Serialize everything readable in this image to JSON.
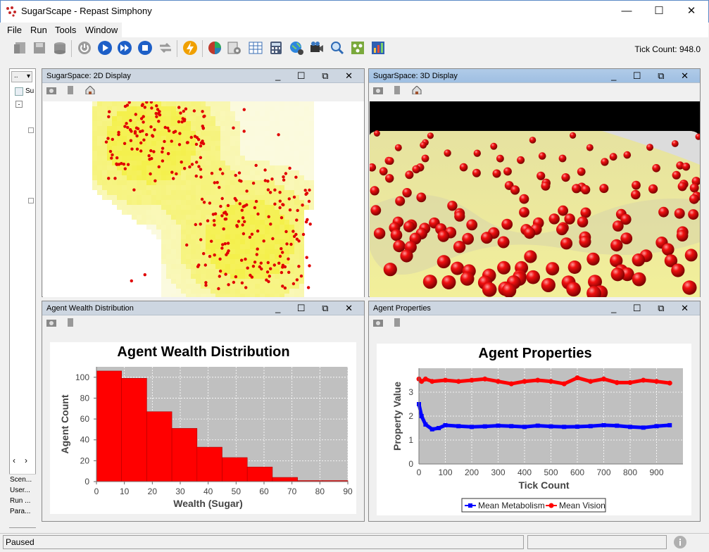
{
  "window": {
    "title": "SugarScape - Repast Simphony"
  },
  "menu": [
    "File",
    "Run",
    "Tools",
    "Window"
  ],
  "toolbar": {
    "tick_count": "Tick Count: 948.0"
  },
  "left_panel": {
    "tab_labels": [
      "Scen...",
      "User...",
      "Run ...",
      "Para..."
    ],
    "tree_item": "Su"
  },
  "frames": {
    "display2d": {
      "title": "SugarSpace: 2D Display"
    },
    "display3d": {
      "title": "SugarSpace: 3D Display"
    },
    "wealth": {
      "title": "Agent Wealth Distribution"
    },
    "props": {
      "title": "Agent Properties"
    }
  },
  "status": {
    "text": "Paused"
  },
  "chart_data": [
    {
      "type": "bar",
      "title": "Agent Wealth Distribution",
      "xlabel": "Wealth (Sugar)",
      "ylabel": "Agent Count",
      "bins": [
        [
          0,
          9
        ],
        [
          9,
          18
        ],
        [
          18,
          27
        ],
        [
          27,
          36
        ],
        [
          36,
          45
        ],
        [
          45,
          54
        ],
        [
          54,
          63
        ],
        [
          63,
          72
        ],
        [
          72,
          81
        ],
        [
          81,
          90
        ]
      ],
      "values": [
        106,
        99,
        67,
        51,
        33,
        23,
        14,
        4,
        1,
        1
      ],
      "xlim": [
        0,
        90
      ],
      "ylim": [
        0,
        110
      ],
      "xticks": [
        0,
        10,
        20,
        30,
        40,
        50,
        60,
        70,
        80,
        90
      ],
      "yticks": [
        0,
        20,
        40,
        60,
        80,
        100
      ],
      "color": "#ff0000",
      "grid": true
    },
    {
      "type": "line",
      "title": "Agent Properties",
      "xlabel": "Tick Count",
      "ylabel": "Property Value",
      "xlim": [
        0,
        1000
      ],
      "ylim": [
        0,
        4
      ],
      "xticks": [
        0,
        100,
        200,
        300,
        400,
        500,
        600,
        700,
        800,
        900
      ],
      "yticks": [
        0,
        1,
        2,
        3
      ],
      "grid": true,
      "legend_position": "bottom",
      "series": [
        {
          "name": "Mean Metabolism",
          "color": "#0000ff",
          "x": [
            0,
            10,
            25,
            50,
            75,
            100,
            150,
            200,
            250,
            300,
            350,
            400,
            450,
            500,
            550,
            600,
            650,
            700,
            750,
            800,
            850,
            900,
            950
          ],
          "y": [
            2.5,
            2.0,
            1.65,
            1.45,
            1.5,
            1.62,
            1.58,
            1.55,
            1.57,
            1.6,
            1.58,
            1.55,
            1.6,
            1.57,
            1.55,
            1.56,
            1.58,
            1.62,
            1.6,
            1.55,
            1.52,
            1.58,
            1.62
          ]
        },
        {
          "name": "Mean Vision",
          "color": "#ff0000",
          "x": [
            0,
            10,
            25,
            50,
            100,
            150,
            200,
            250,
            300,
            350,
            400,
            450,
            500,
            550,
            600,
            650,
            700,
            750,
            800,
            850,
            900,
            950
          ],
          "y": [
            3.55,
            3.45,
            3.55,
            3.45,
            3.5,
            3.45,
            3.5,
            3.55,
            3.45,
            3.35,
            3.45,
            3.5,
            3.45,
            3.35,
            3.6,
            3.45,
            3.55,
            3.4,
            3.4,
            3.5,
            3.45,
            3.38
          ]
        }
      ]
    }
  ]
}
